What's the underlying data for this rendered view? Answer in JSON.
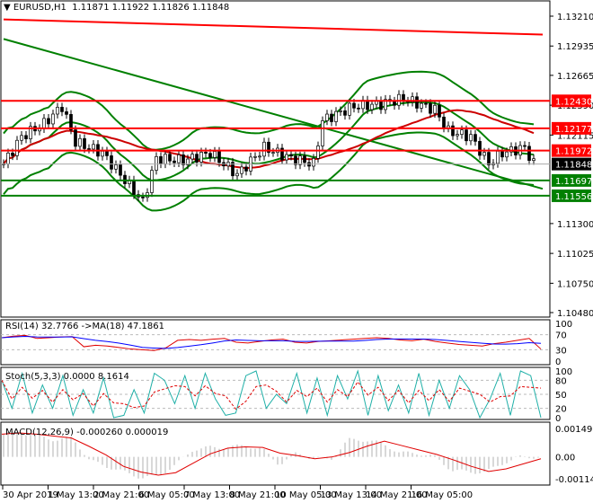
{
  "header": {
    "symbol": "EURUSD,H1",
    "ohlc": "1.11871 1.11922 1.11826 1.11848"
  },
  "chart_data": {
    "type": "candlestick",
    "title": "EURUSD,H1",
    "ohlc_last": {
      "open": 1.11871,
      "high": 1.11922,
      "low": 1.11826,
      "close": 1.11848
    },
    "ylim": [
      1.1048,
      1.1321
    ],
    "price_ticks": [
      "1.13210",
      "1.12935",
      "1.12665",
      "1.12390",
      "1.12115",
      "1.11300",
      "1.11025",
      "1.10750",
      "1.10480"
    ],
    "x_ticks": [
      "30 Apr 2019",
      "1 May 13:00",
      "2 May 21:00",
      "6 May 05:00",
      "7 May 13:00",
      "8 May 21:00",
      "10 May 05:00",
      "13 May 13:00",
      "14 May 21:00",
      "16 May 05:00"
    ],
    "price_path": [
      [
        0,
        1.1185
      ],
      [
        4,
        1.121
      ],
      [
        9,
        1.1222
      ],
      [
        13,
        1.1238
      ],
      [
        16,
        1.1205
      ],
      [
        22,
        1.1195
      ],
      [
        28,
        1.1165
      ],
      [
        31,
        1.115
      ],
      [
        34,
        1.119
      ],
      [
        40,
        1.1188
      ],
      [
        46,
        1.1195
      ],
      [
        52,
        1.1175
      ],
      [
        58,
        1.12
      ],
      [
        64,
        1.119
      ],
      [
        69,
        1.1185
      ],
      [
        71,
        1.1225
      ],
      [
        78,
        1.1238
      ],
      [
        84,
        1.124
      ],
      [
        89,
        1.1245
      ],
      [
        96,
        1.1235
      ],
      [
        99,
        1.1215
      ],
      [
        104,
        1.121
      ],
      [
        108,
        1.1185
      ],
      [
        111,
        1.1195
      ],
      [
        116,
        1.12
      ],
      [
        118,
        1.1185
      ]
    ],
    "levels": [
      {
        "value": "1.12430",
        "color": "#ff0000"
      },
      {
        "value": "1.12177",
        "color": "#ff0000"
      },
      {
        "value": "1.11972",
        "color": "#ff0000"
      },
      {
        "value": "1.11848",
        "color": "#000000",
        "current": true
      },
      {
        "value": "1.11697",
        "color": "#008000"
      },
      {
        "value": "1.11556",
        "color": "#008000"
      }
    ],
    "trendlines": [
      {
        "color": "#008000",
        "from": [
          0,
          1.13
        ],
        "to": [
          120,
          1.1162
        ]
      },
      {
        "color": "#ff0000",
        "from": [
          0,
          1.1318
        ],
        "to": [
          120,
          1.1304
        ]
      }
    ],
    "rsi": {
      "label": "RSI(14) 32.7766  ->MA(18) 47.1861",
      "ticks": [
        "100",
        "70",
        "30",
        "0"
      ],
      "values": [
        62,
        66,
        68,
        60,
        62,
        64,
        65,
        38,
        42,
        40,
        36,
        32,
        30,
        28,
        35,
        55,
        57,
        55,
        58,
        60,
        50,
        48,
        52,
        56,
        58,
        50,
        48,
        52,
        54,
        56,
        58,
        60,
        62,
        60,
        56,
        54,
        58,
        52,
        48,
        44,
        42,
        40,
        46,
        50,
        55,
        60,
        32
      ]
    },
    "stoch": {
      "label": "Stoch(5,3,3) 0.0000 8.1614",
      "ticks": [
        "100",
        "80",
        "50",
        "20",
        "0"
      ],
      "values": [
        80,
        20,
        95,
        10,
        70,
        20,
        90,
        5,
        60,
        10,
        85,
        0,
        5,
        60,
        10,
        95,
        80,
        30,
        90,
        20,
        95,
        40,
        5,
        10,
        90,
        100,
        20,
        50,
        30,
        95,
        10,
        85,
        5,
        90,
        40,
        100,
        5,
        90,
        15,
        70,
        10,
        95,
        5,
        80,
        20,
        90,
        60,
        0,
        40,
        95,
        5,
        100,
        90,
        0
      ]
    },
    "macd": {
      "label": "MACD(12,26,9) -0.000260 0.000019",
      "ticks": [
        "0.001497",
        "0.00",
        "-0.001148"
      ],
      "values": [
        0.0012,
        0.0013,
        0.0011,
        0.0009,
        0.001,
        -0.0002,
        -0.0005,
        -0.0008,
        -0.0011,
        -0.001,
        -0.0004,
        0.0004,
        0.0005,
        0.0005,
        0.0006,
        0.0004,
        -0.0004,
        0.0002,
        -0.0001,
        -0.0001,
        0.0009,
        0.0009,
        0.0007,
        0.0002,
        0.0002,
        0.0,
        -0.0007,
        -0.0008,
        -0.0008,
        -0.0003,
        0.0,
        0.0
      ]
    }
  }
}
